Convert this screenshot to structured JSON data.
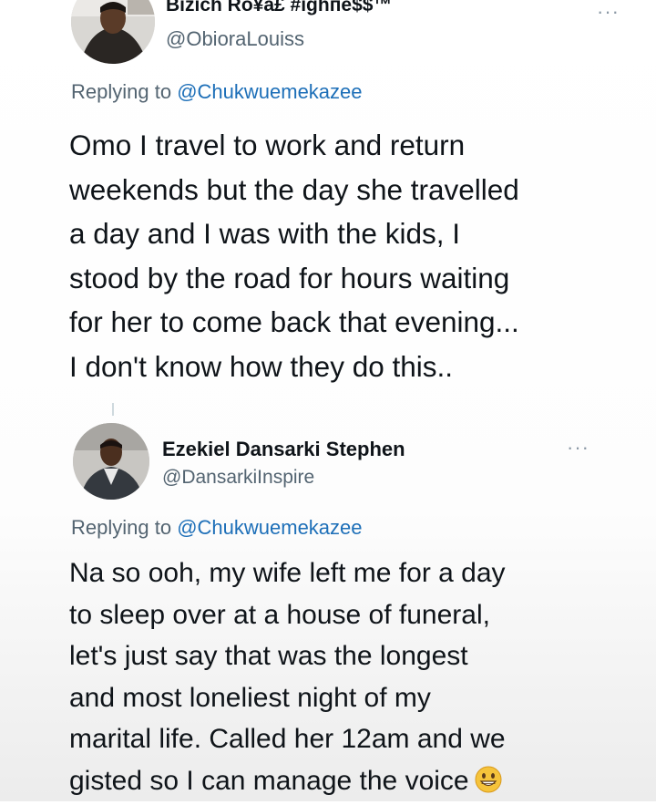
{
  "tweet1": {
    "display_name": "Bizich Ro¥a£ #ighпe$$™",
    "handle": "@ObioraLouiss",
    "replying_prefix": "Replying to ",
    "replying_mention": "@Chukwuemekazee",
    "body_lines": [
      "Omo I travel to work and return",
      "weekends but the day she travelled",
      "a day and I was with the kids, I",
      "stood by the road for hours waiting",
      "for her to come back that evening...",
      "I don't know how they do this.."
    ]
  },
  "tweet2": {
    "display_name": "Ezekiel Dansarki Stephen",
    "handle": "@DansarkiInspire",
    "replying_prefix": "Replying to ",
    "replying_mention": "@Chukwuemekazee",
    "body_lines": [
      "Na so ooh, my wife left me for a day",
      "to sleep over at a house of funeral,",
      "let's just say that was the longest",
      "and most loneliest night of my",
      "marital life. Called her 12am and we",
      "gisted so I can manage the voice"
    ],
    "trailing_emoji": "grinning-face-emoji"
  },
  "icons": {
    "more": "more-options-icon"
  },
  "colors": {
    "text": "#0f1419",
    "secondary": "#536471",
    "mention": "#1d6fb8"
  }
}
